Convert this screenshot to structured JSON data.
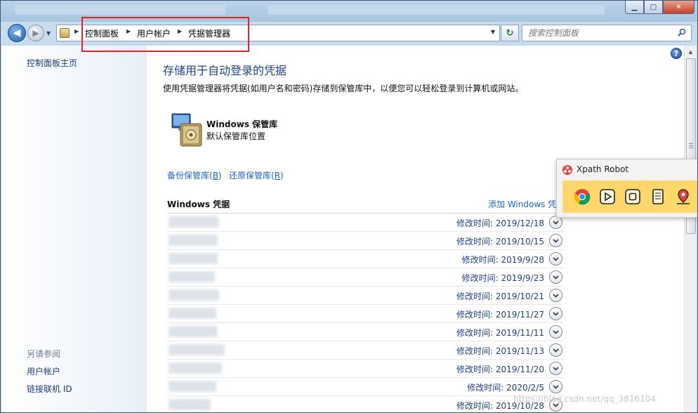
{
  "window": {
    "breadcrumb": [
      "控制面板",
      "用户帐户",
      "凭据管理器"
    ],
    "search_placeholder": "搜索控制面板",
    "buttons": {
      "minimize": "▁",
      "maximize": "□",
      "close": "✕"
    }
  },
  "sidebar": {
    "home": "控制面板主页",
    "see_also": "另请参阅",
    "links": [
      "用户帐户",
      "链接联机 ID"
    ]
  },
  "main": {
    "title": "存储用于自动登录的凭据",
    "description": "使用凭据管理器将凭据(如用户名和密码)存储到保管库中，以便您可以轻松登录到计算机或网站。",
    "vault": {
      "name": "Windows 保管库",
      "subtitle": "默认保管库位置"
    },
    "backup_link": {
      "text": "备份保管库(",
      "key": "B",
      "end": ")"
    },
    "restore_link": {
      "text": "还原保管库(",
      "key": "R",
      "end": ")"
    },
    "section_title": "Windows 凭据",
    "add_link": "添加 Windows 凭据",
    "credentials": [
      {
        "modified": "修改时间:  2019/12/18"
      },
      {
        "modified": "修改时间:  2019/10/15"
      },
      {
        "modified": "修改时间:  2019/9/28"
      },
      {
        "modified": "修改时间:  2019/9/23"
      },
      {
        "modified": "修改时间:  2019/10/21"
      },
      {
        "modified": "修改时间:  2019/11/27"
      },
      {
        "modified": "修改时间:  2019/11/11"
      },
      {
        "modified": "修改时间:  2019/11/13"
      },
      {
        "modified": "修改时间:  2019/11/20"
      },
      {
        "modified": "修改时间:  2020/2/5"
      },
      {
        "modified": "修改时间:  2019/10/28"
      }
    ]
  },
  "xpath_robot": {
    "title": "Xpath Robot",
    "tools": [
      "chrome-icon",
      "play-icon",
      "stop-icon",
      "document-icon",
      "location-pin-icon"
    ],
    "accent": "#ffd76b"
  },
  "watermark": "https://blog.csdn.net/qq_3816104",
  "colors": {
    "highlight": "#e0222b",
    "link": "#1b66c9",
    "title": "#1e3f8c"
  }
}
